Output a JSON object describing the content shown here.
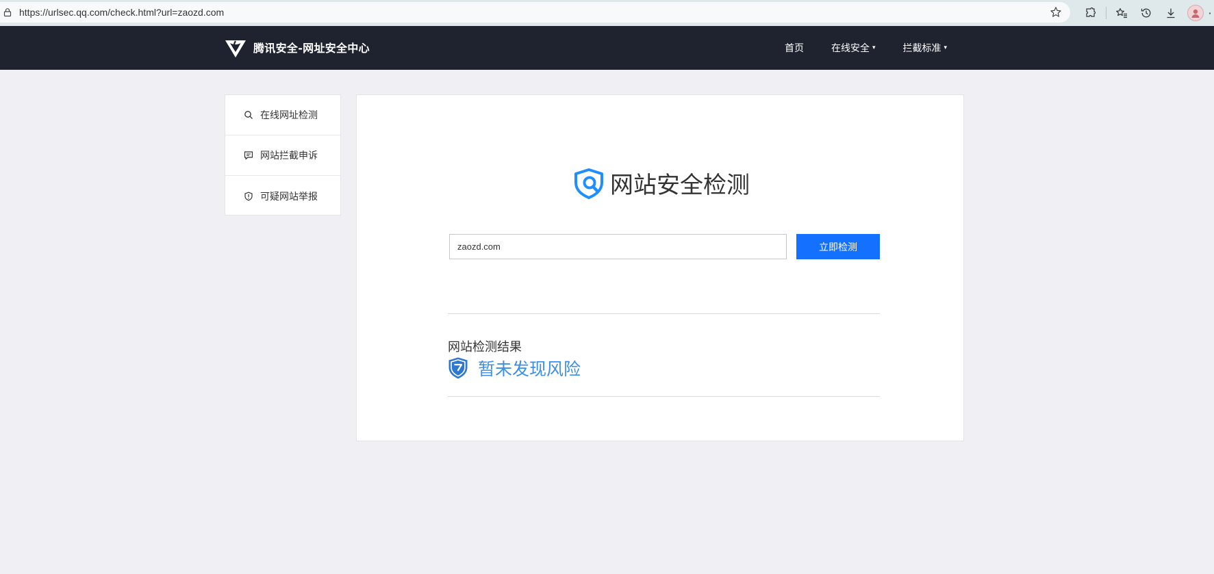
{
  "browser": {
    "url": "https://urlsec.qq.com/check.html?url=zaozd.com",
    "toolbar_icons": [
      "star-icon",
      "extensions-icon",
      "favorites-icon",
      "history-icon",
      "download-icon",
      "avatar"
    ]
  },
  "header": {
    "logo_text": "腾讯安全-网址安全中心",
    "nav": [
      {
        "label": "首页",
        "has_caret": false
      },
      {
        "label": "在线安全",
        "has_caret": true
      },
      {
        "label": "拦截标准",
        "has_caret": true
      }
    ],
    "caret": "▾"
  },
  "sidebar": {
    "items": [
      {
        "label": "在线网址检测",
        "icon": "search-icon"
      },
      {
        "label": "网站拦截申诉",
        "icon": "message-icon"
      },
      {
        "label": "可疑网站举报",
        "icon": "shield-icon"
      }
    ]
  },
  "main": {
    "title": "网站安全检测",
    "input_value": "zaozd.com",
    "check_button": "立即检测",
    "result_label": "网站检测结果",
    "result_text": "暂未发现风险"
  },
  "colors": {
    "header_bg": "#1f2330",
    "accent": "#1471ff",
    "result_text": "#3b8fe6",
    "page_bg": "#efeff4"
  }
}
